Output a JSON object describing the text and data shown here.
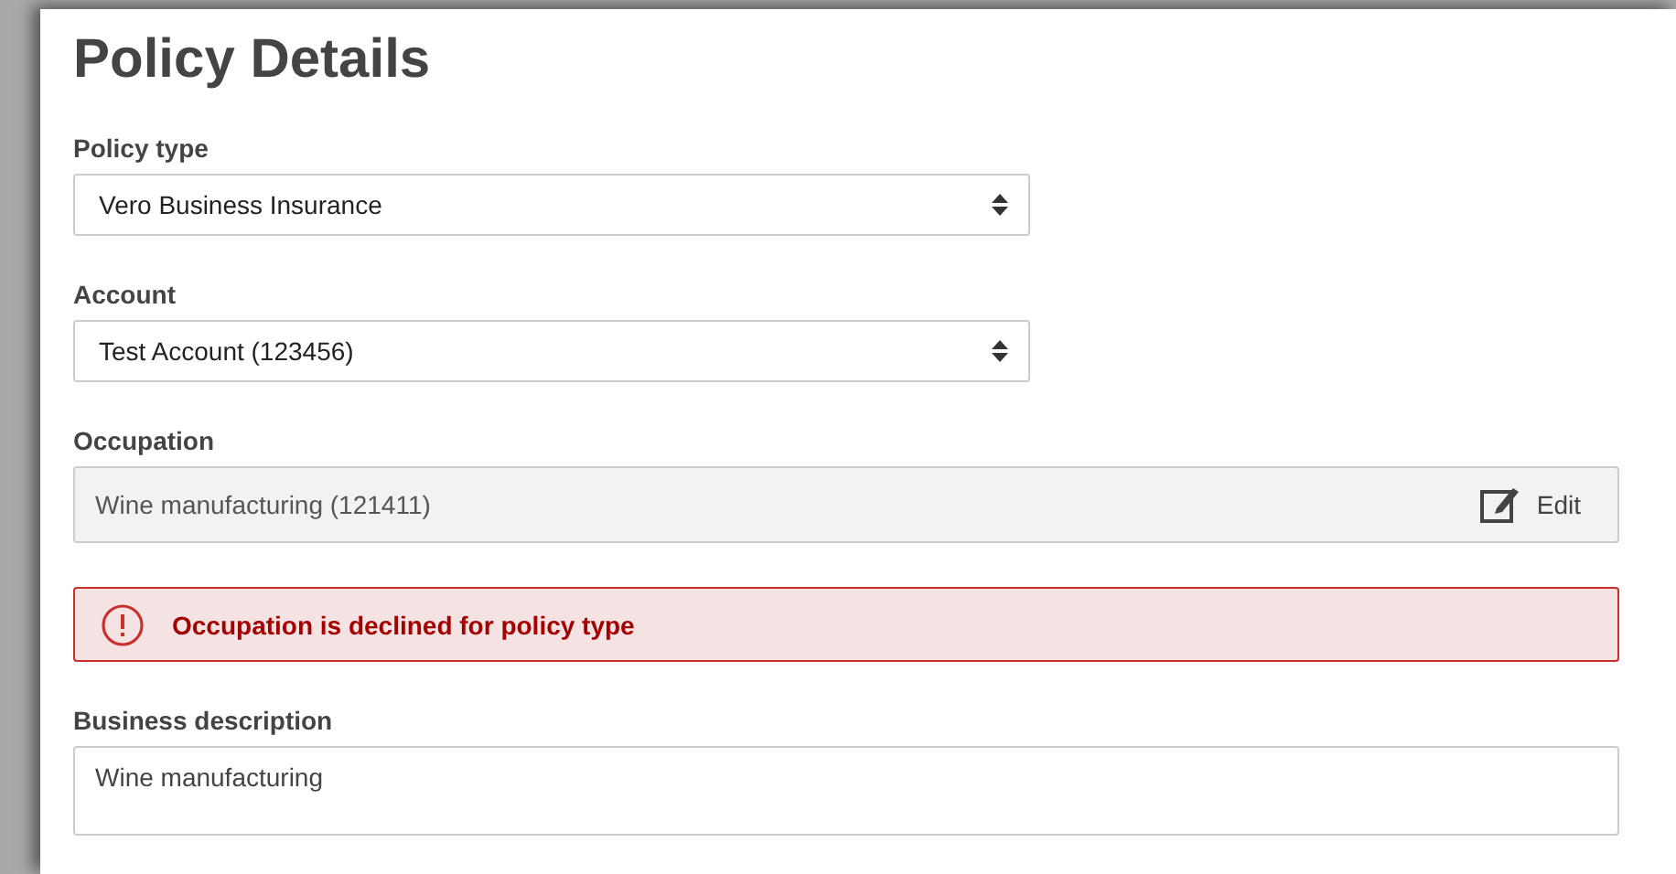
{
  "title": "Policy Details",
  "fields": [
    {
      "kind": "select",
      "label": "Policy type",
      "value": "Vero Business Insurance"
    },
    {
      "kind": "select",
      "label": "Account",
      "value": "Test Account (123456)"
    },
    {
      "kind": "readonly",
      "label": "Occupation",
      "value": "Wine manufacturing (121411)",
      "action": "Edit"
    },
    {
      "kind": "alert",
      "message": "Occupation is declined for policy type"
    },
    {
      "kind": "textarea",
      "label": "Business description",
      "value": "Wine manufacturing"
    }
  ]
}
